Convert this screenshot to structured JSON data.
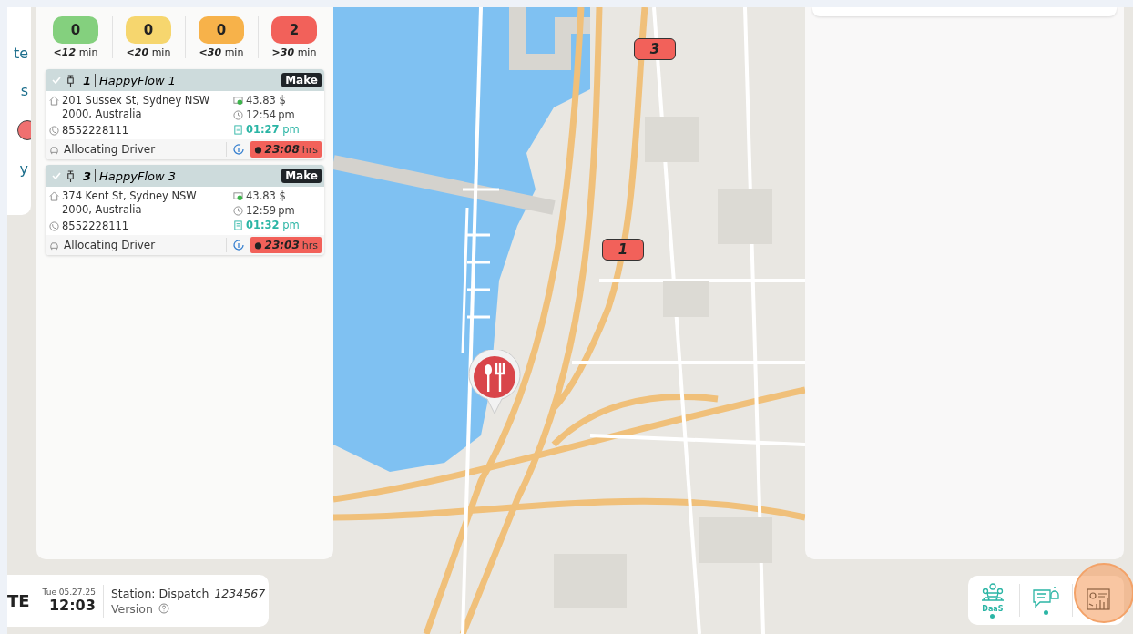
{
  "side_menu": {
    "items": [
      {
        "kind": "text",
        "label": "te"
      },
      {
        "kind": "text",
        "label": "s"
      },
      {
        "kind": "dot",
        "color": "#f07070"
      },
      {
        "kind": "text",
        "label": "y"
      }
    ]
  },
  "counters": [
    {
      "count": "0",
      "threshold": "<12",
      "unit": "min",
      "color": "#84d07e"
    },
    {
      "count": "0",
      "threshold": "<20",
      "unit": "min",
      "color": "#f6d66e"
    },
    {
      "count": "0",
      "threshold": "<30",
      "unit": "min",
      "color": "#f7b24a"
    },
    {
      "count": "2",
      "threshold": ">30",
      "unit": "min",
      "color": "#f2615a"
    }
  ],
  "orders": [
    {
      "number": "1",
      "name": "HappyFlow 1",
      "badge": "Make",
      "address": "201 Sussex St, Sydney NSW 2000, Australia",
      "phone": "8552228111",
      "price": "43.83 $",
      "time": "12:54",
      "time_unit": "pm",
      "due": "01:27",
      "due_unit": "pm",
      "status": "Allocating Driver",
      "timer": "23:08",
      "timer_unit": "hrs"
    },
    {
      "number": "3",
      "name": "HappyFlow 3",
      "badge": "Make",
      "address": "374 Kent St, Sydney NSW 2000, Australia",
      "phone": "8552228111",
      "price": "43.83 $",
      "time": "12:59",
      "time_unit": "pm",
      "due": "01:32",
      "due_unit": "pm",
      "status": "Allocating Driver",
      "timer": "23:03",
      "timer_unit": "hrs"
    }
  ],
  "map_markers": [
    {
      "label": "3"
    },
    {
      "label": "1"
    }
  ],
  "footer": {
    "brand": "TE",
    "date": "Tue 05.27.25",
    "time": "12:03",
    "station": "Station: Dispatch",
    "station_id": "1234567",
    "version": "Version"
  },
  "toolbar": [
    {
      "kind": "fleet",
      "label": "DaaS",
      "indicator": true,
      "highlighted": false
    },
    {
      "kind": "chat",
      "indicator": true,
      "highlighted": false
    },
    {
      "kind": "report",
      "indicator": false,
      "highlighted": true
    }
  ]
}
